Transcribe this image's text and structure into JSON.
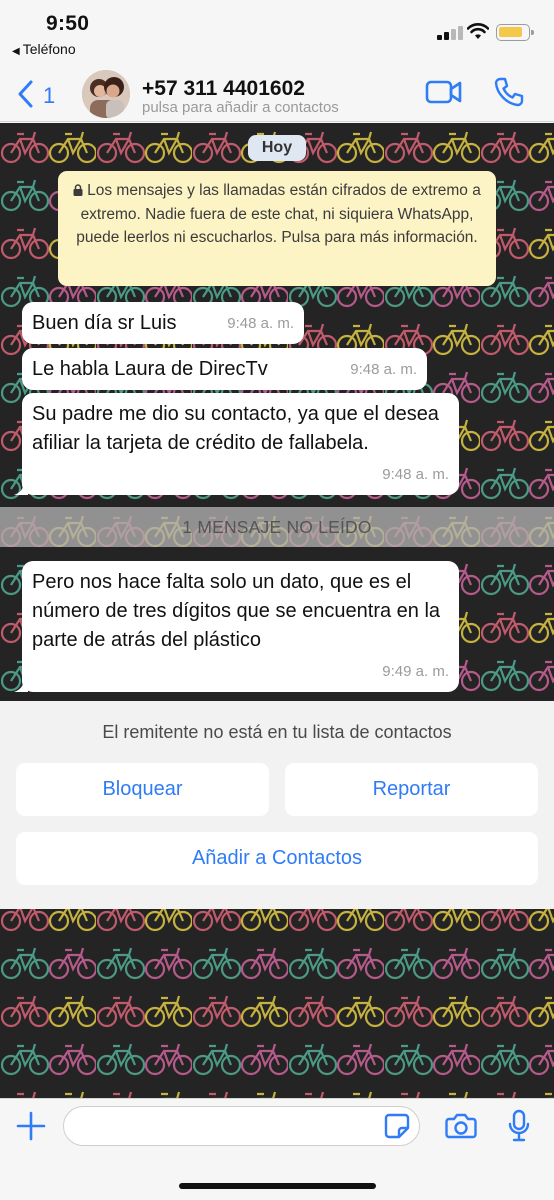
{
  "status_bar": {
    "time": "9:50",
    "back_app": "Teléfono",
    "battery_color": "#f5c84b"
  },
  "header": {
    "back_count": "1",
    "contact_name": "+57 311 4401602",
    "contact_subtitle": "pulsa para añadir a contactos",
    "accent_color": "#2f7cf6",
    "icons": [
      "chevron-left-icon",
      "video-call-icon",
      "phone-call-icon"
    ]
  },
  "chat": {
    "date_label": "Hoy",
    "encryption_notice": "Los mensajes y las llamadas están cifrados de extremo a extremo. Nadie fuera de este chat, ni siquiera WhatsApp, puede leerlos ni escucharlos. Pulsa para más información.",
    "messages": [
      {
        "text": "Buen día sr Luis",
        "time": "9:48 a. m."
      },
      {
        "text": "Le habla Laura de DirecTv",
        "time": "9:48 a. m."
      },
      {
        "text": "Su padre me dio su contacto, ya que el desea afiliar la tarjeta de crédito de fallabela.",
        "time": "9:48 a. m."
      },
      {
        "text": "Pero nos hace falta solo un dato, que es el número de tres dígitos que se encuentra en la parte de atrás del plástico",
        "time": "9:49 a. m."
      }
    ],
    "unread_divider": "1 MENSAJE NO LEÍDO"
  },
  "unknown_sender": {
    "notice": "El remitente no está en tu lista de contactos",
    "block_label": "Bloquear",
    "report_label": "Reportar",
    "add_contact_label": "Añadir a Contactos"
  },
  "input_bar": {
    "message_value": "",
    "icons": [
      "plus-icon",
      "sticker-icon",
      "camera-icon",
      "microphone-icon"
    ]
  }
}
